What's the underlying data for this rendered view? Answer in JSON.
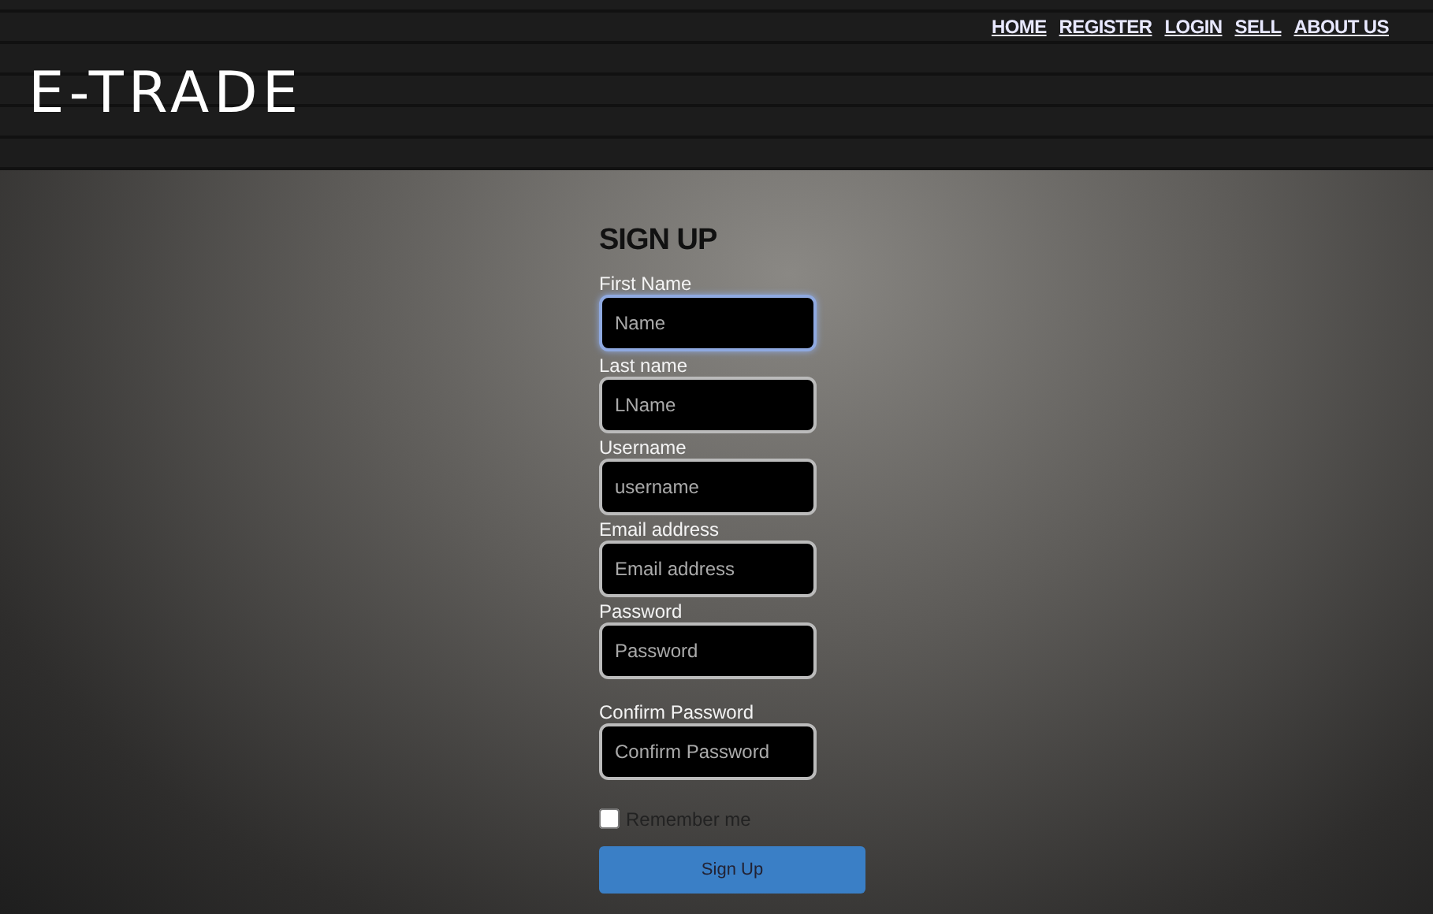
{
  "nav": [
    {
      "label": "HOME"
    },
    {
      "label": "REGISTER"
    },
    {
      "label": "LOGIN"
    },
    {
      "label": "SELL"
    },
    {
      "label": "ABOUT US"
    }
  ],
  "logo": "E-TRADE",
  "form": {
    "title": "SIGN UP",
    "fields": [
      {
        "label": "First Name",
        "placeholder": "Name",
        "focused": true
      },
      {
        "label": "Last name",
        "placeholder": "LName",
        "focused": false
      },
      {
        "label": "Username",
        "placeholder": "username",
        "focused": false
      },
      {
        "label": "Email address",
        "placeholder": "Email address",
        "focused": false
      },
      {
        "label": "Password",
        "placeholder": "Password",
        "focused": false
      },
      {
        "label": "Confirm Password",
        "placeholder": "Confirm Password",
        "focused": false
      }
    ],
    "remember": {
      "label": "Remember me",
      "checked": false
    },
    "submit": "Sign Up"
  }
}
